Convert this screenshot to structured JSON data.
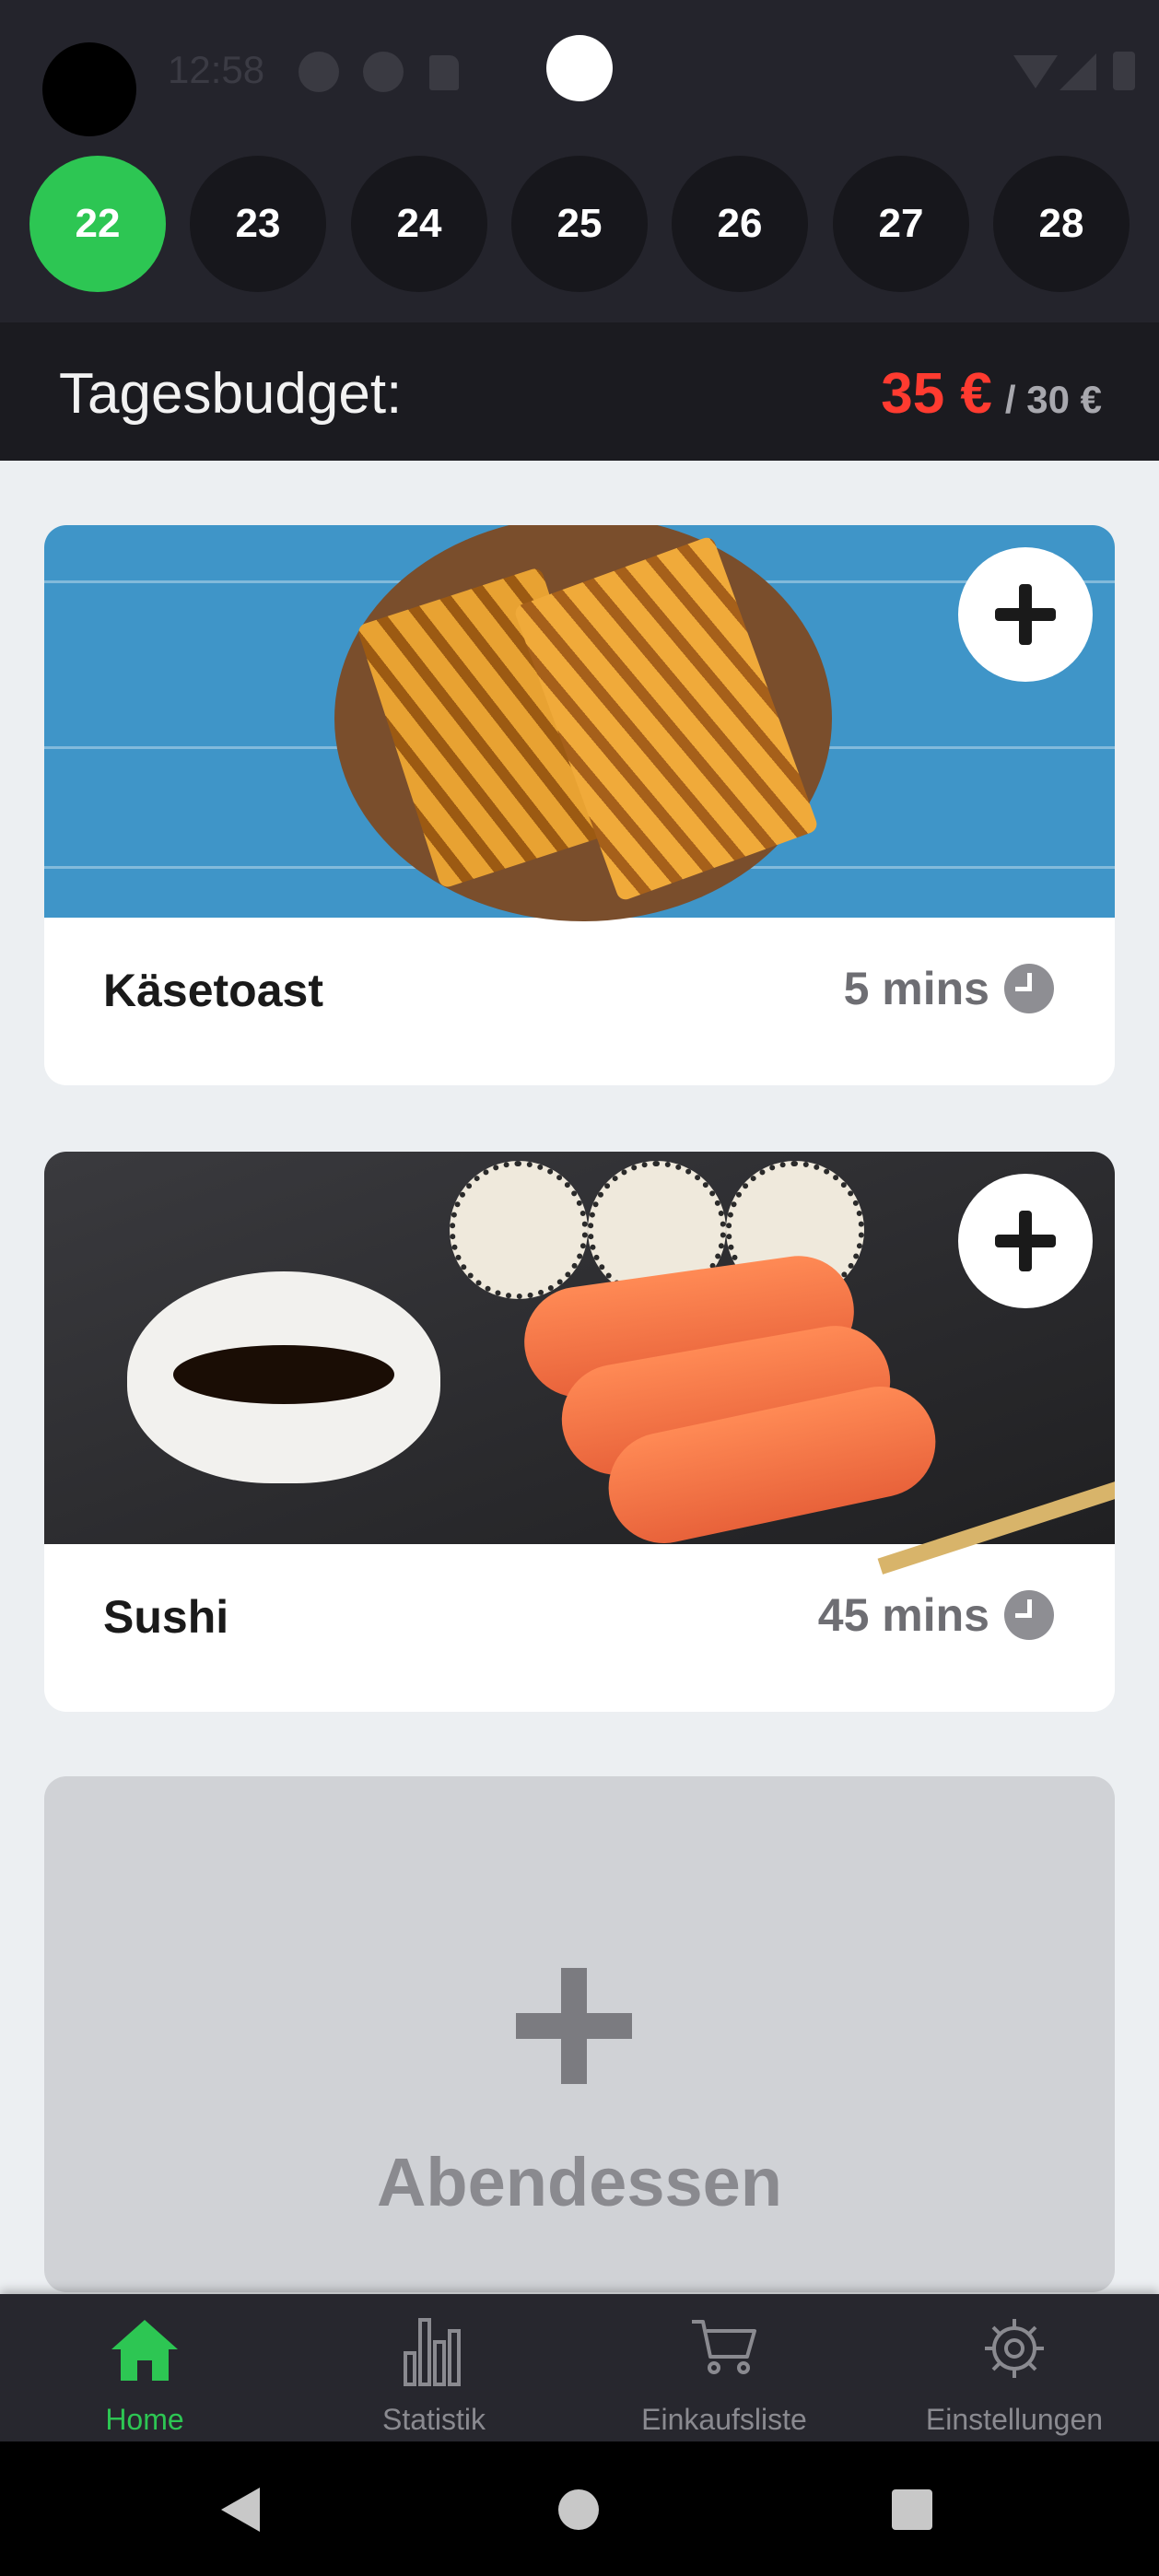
{
  "status_bar": {
    "time": "12:58"
  },
  "days": [
    "22",
    "23",
    "24",
    "25",
    "26",
    "27",
    "28"
  ],
  "selected_day": "22",
  "budget": {
    "label": "Tagesbudget:",
    "spent": "35 €",
    "total": "/ 30 €"
  },
  "meals": [
    {
      "name": "Käsetoast",
      "time": "5 mins"
    },
    {
      "name": "Sushi",
      "time": "45 mins"
    }
  ],
  "dinner_placeholder": {
    "label": "Abendessen"
  },
  "bottom_nav": {
    "items": [
      {
        "label": "Home",
        "icon": "home-icon",
        "active": true
      },
      {
        "label": "Statistik",
        "icon": "bar-chart-icon",
        "active": false
      },
      {
        "label": "Einkaufsliste",
        "icon": "cart-icon",
        "active": false
      },
      {
        "label": "Einstellungen",
        "icon": "gear-icon",
        "active": false
      }
    ]
  },
  "colors": {
    "accent": "#2dc653",
    "over_budget": "#ff3b30",
    "header_bg": "#24242c"
  }
}
